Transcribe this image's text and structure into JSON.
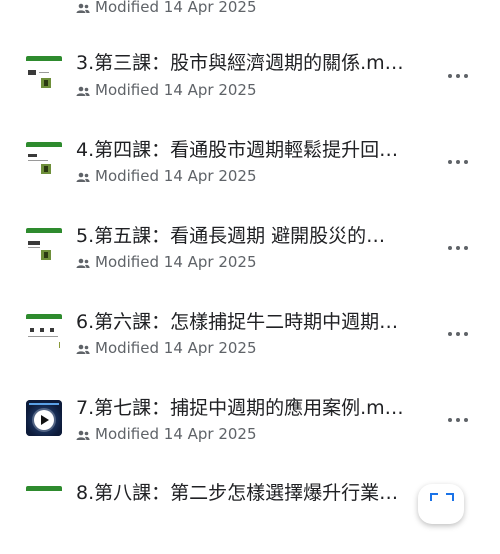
{
  "files": [
    {
      "title": "",
      "modified": "Modified 14 Apr 2025",
      "thumb": "slide"
    },
    {
      "title": "3.第三課：股市與經濟週期的關係.m…",
      "modified": "Modified 14 Apr 2025",
      "thumb": "slide"
    },
    {
      "title": "4.第四課：看通股市週期輕鬆提升回…",
      "modified": "Modified 14 Apr 2025",
      "thumb": "slide"
    },
    {
      "title": "5.第五課：看通長週期 避開股災的…",
      "modified": "Modified 14 Apr 2025",
      "thumb": "slide"
    },
    {
      "title": "6.第六課：怎樣捕捉牛二時期中週期…",
      "modified": "Modified 14 Apr 2025",
      "thumb": "slide"
    },
    {
      "title": "7.第七課：捕捉中週期的應用案例.m…",
      "modified": "Modified 14 Apr 2025",
      "thumb": "video"
    },
    {
      "title": "8.第八課：第二步怎樣選擇爆升行業…",
      "modified": "",
      "thumb": "slide"
    }
  ],
  "icons": {
    "shared": "people-icon",
    "more": "more-vert-icon",
    "fab": "scan-icon",
    "video": "play-icon"
  },
  "colors": {
    "accent": "#2e8b2e",
    "text": "#202124",
    "secondary": "#5f6368",
    "fab_icon": "#1a73e8"
  }
}
